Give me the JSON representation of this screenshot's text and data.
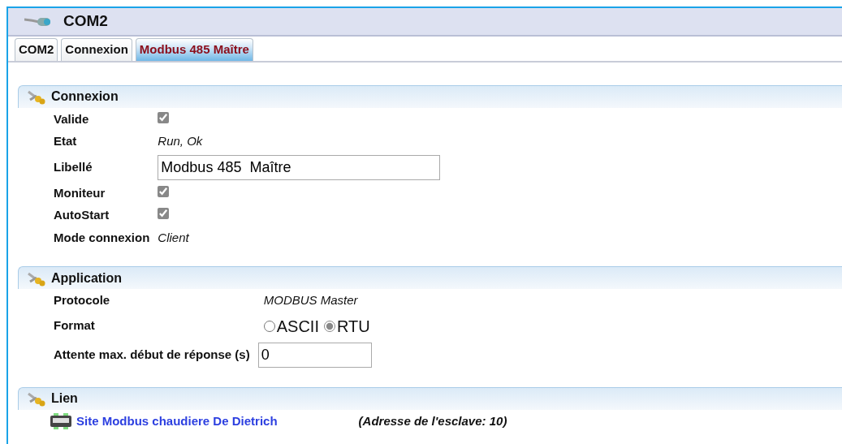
{
  "window": {
    "title": "COM2"
  },
  "tabs": [
    {
      "label": "COM2",
      "selected": false
    },
    {
      "label": "Connexion",
      "selected": false
    },
    {
      "label": "Modbus 485  Maître",
      "selected": true
    }
  ],
  "sections": [
    {
      "title": "Connexion",
      "rows": [
        {
          "kind": "checkbox",
          "label": "Valide",
          "checked": true
        },
        {
          "kind": "text",
          "label": "Etat",
          "value": "Run, Ok"
        },
        {
          "kind": "input",
          "label": "Libellé",
          "value": "Modbus 485  Maître"
        },
        {
          "kind": "checkbox",
          "label": "Moniteur",
          "checked": true
        },
        {
          "kind": "checkbox",
          "label": "AutoStart",
          "checked": true
        },
        {
          "kind": "text",
          "label": "Mode connexion",
          "value": "Client"
        }
      ]
    },
    {
      "title": "Application",
      "rows": [
        {
          "kind": "text",
          "label": "Protocole",
          "value": "MODBUS Master"
        },
        {
          "kind": "radio",
          "label": "Format",
          "options": [
            {
              "label": "ASCII",
              "selected": false
            },
            {
              "label": "RTU",
              "selected": true
            }
          ]
        },
        {
          "kind": "input",
          "label": "Attente max. début de réponse (s)",
          "value": "0"
        }
      ]
    },
    {
      "title": "Lien",
      "rows": [
        {
          "kind": "link",
          "label": "Site Modbus chaudiere De Dietrich",
          "value": "(Adresse de l'esclave: 10)"
        }
      ]
    }
  ]
}
